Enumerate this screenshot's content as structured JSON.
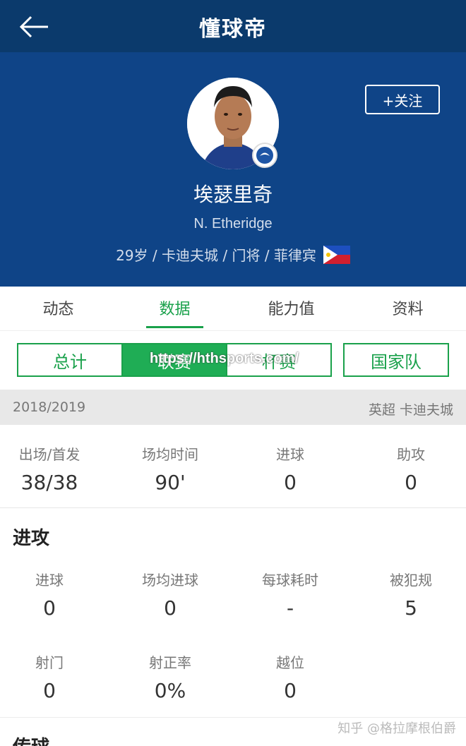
{
  "app": {
    "title": "懂球帝",
    "back_icon": "arrow-left-icon"
  },
  "player": {
    "name_cn": "埃瑟里奇",
    "name_en": "N. Etheridge",
    "info": "29岁 / 卡迪夫城 / 门将 / 菲律宾",
    "follow_label": "+关注",
    "flag": "philippines-flag-icon"
  },
  "tabs": [
    "动态",
    "数据",
    "能力值",
    "资料"
  ],
  "active_tab": "数据",
  "segments": [
    "总计",
    "联赛",
    "杯赛",
    "国家队"
  ],
  "active_segment": "联赛",
  "watermark": "https://hthsports.com/",
  "season": {
    "year": "2018/2019",
    "league": "英超 卡迪夫城"
  },
  "summary": [
    {
      "label": "出场/首发",
      "value": "38/38"
    },
    {
      "label": "场均时间",
      "value": "90'"
    },
    {
      "label": "进球",
      "value": "0"
    },
    {
      "label": "助攻",
      "value": "0"
    }
  ],
  "attack": {
    "title": "进攻",
    "row1": [
      {
        "label": "进球",
        "value": "0"
      },
      {
        "label": "场均进球",
        "value": "0"
      },
      {
        "label": "每球耗时",
        "value": "-"
      },
      {
        "label": "被犯规",
        "value": "5"
      }
    ],
    "row2": [
      {
        "label": "射门",
        "value": "0"
      },
      {
        "label": "射正率",
        "value": "0%"
      },
      {
        "label": "越位",
        "value": "0"
      }
    ]
  },
  "next_section": {
    "title": "传球"
  },
  "credit": "知乎 @格拉摩根伯爵",
  "colors": {
    "header": "#0f4487",
    "topbar": "#0b3a6c",
    "accent": "#1aa14b"
  }
}
